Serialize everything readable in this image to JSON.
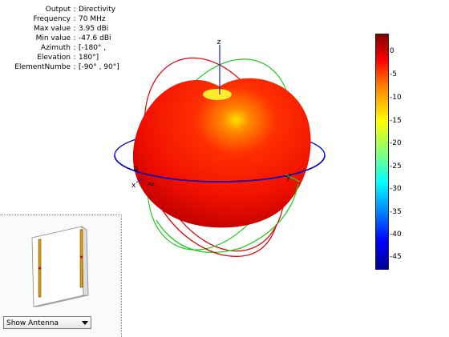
{
  "info": [
    {
      "key": "Output",
      "value": "Directivity"
    },
    {
      "key": "Frequency",
      "value": "70 MHz"
    },
    {
      "key": "Max value",
      "value": "3.95 dBi"
    },
    {
      "key": "Min value",
      "value": "-47.6 dBi"
    },
    {
      "key": "Azimuth",
      "value": "[-180° ,"
    },
    {
      "key": "Elevation",
      "value": "180°]"
    },
    {
      "key": "ElementNumbe",
      "value": "[-90° , 90°]"
    }
  ],
  "axes": {
    "x": "x",
    "y": "y",
    "z": "z",
    "az": "Az",
    "el": "El"
  },
  "colorbar": {
    "ticks": [
      "0",
      "-5",
      "-10",
      "-15",
      "-20",
      "-25",
      "-30",
      "-35",
      "-40",
      "-45"
    ]
  },
  "colors": {
    "pattern": "#ff1a00",
    "azimuth_circle": "#0000cc",
    "elevation_circle_red": "#e00000",
    "elevation_circle_green": "#22cc22"
  },
  "dropdown": {
    "selected": "Show Antenna"
  }
}
